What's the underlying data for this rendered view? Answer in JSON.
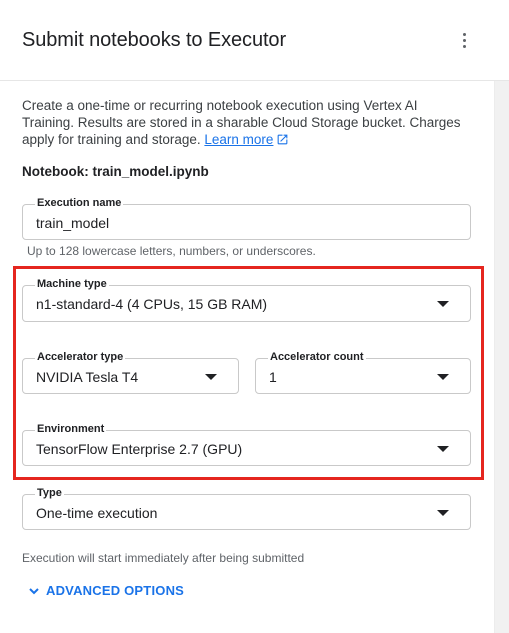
{
  "header": {
    "title": "Submit notebooks to Executor",
    "more_icon": "more-vert-icon"
  },
  "description": {
    "text": "Create a one-time or recurring notebook execution using Vertex AI Training. Results are stored in a sharable Cloud Storage bucket. Charges apply for training and storage.",
    "link_label": "Learn more",
    "link_icon": "open-in-new-icon"
  },
  "notebook_label": "Notebook: train_model.ipynb",
  "execution_name": {
    "label": "Execution name",
    "value": "train_model",
    "hint": "Up to 128 lowercase letters, numbers, or underscores."
  },
  "machine_type": {
    "label": "Machine type",
    "value": "n1-standard-4 (4 CPUs, 15 GB RAM)"
  },
  "accelerator_type": {
    "label": "Accelerator type",
    "value": "NVIDIA Tesla T4"
  },
  "accelerator_count": {
    "label": "Accelerator count",
    "value": "1"
  },
  "environment": {
    "label": "Environment",
    "value": "TensorFlow Enterprise 2.7 (GPU)"
  },
  "type": {
    "label": "Type",
    "value": "One-time execution",
    "hint": "Execution will start immediately after being submitted"
  },
  "advanced_options": {
    "label": "ADVANCED OPTIONS",
    "icon": "chevron-down-icon"
  },
  "colors": {
    "accent": "#1a73e8",
    "highlight": "#e5261f"
  }
}
